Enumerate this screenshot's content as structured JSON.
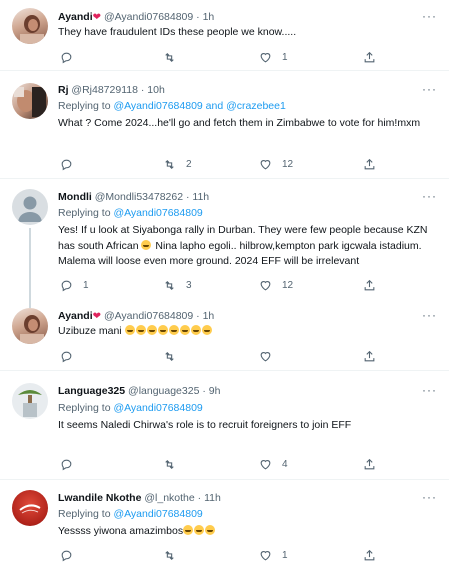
{
  "colors": {
    "link": "#1d9bf0",
    "secondary": "#536471",
    "text": "#0f1419",
    "heart": "#e0245e"
  },
  "tweets": [
    {
      "name": "Ayandi",
      "handle": "@Ayandi07684809",
      "time": "1h",
      "text": "They have fraudulent IDs these people we know.....",
      "replies": "",
      "retweets": "",
      "likes": "1",
      "share": ""
    },
    {
      "name": "Rj",
      "handle": "@Rj48729118",
      "time": "10h",
      "replying_prefix": "Replying to",
      "replying_to": "@Ayandi07684809",
      "replying_and": "and",
      "replying_to2": "@crazebee1",
      "text": "What ?  Come 2024...he'll go and fetch them in Zimbabwe to vote for him!mxm",
      "replies": "",
      "retweets": "2",
      "likes": "12",
      "share": ""
    },
    {
      "name": "Mondli",
      "handle": "@Mondli53478262",
      "time": "11h",
      "replying_prefix": "Replying to",
      "replying_to": "@Ayandi07684809",
      "text_a": "Yes! If u look at Siyabonga rally in Durban. They were few people because KZN has south African",
      "text_b": "Nina lapho egoli.. hilbrow,kempton park  igcwala istadium. Malema will loose even more ground. 2024 EFF will be irrelevant",
      "replies": "1",
      "retweets": "3",
      "likes": "12",
      "share": ""
    },
    {
      "name": "Ayandi",
      "handle": "@Ayandi07684809",
      "time": "1h",
      "text": "Uzibuze mani",
      "replies": "",
      "retweets": "",
      "likes": "",
      "share": ""
    },
    {
      "name": "Language325",
      "handle": "@language325",
      "time": "9h",
      "replying_prefix": "Replying to",
      "replying_to": "@Ayandi07684809",
      "text": "It seems Naledi Chirwa's role is to recruit foreigners to join EFF",
      "replies": "",
      "retweets": "",
      "likes": "4",
      "share": ""
    },
    {
      "name": "Lwandile Nkothe",
      "handle": "@l_nkothe",
      "time": "11h",
      "replying_prefix": "Replying to",
      "replying_to": "@Ayandi07684809",
      "text": "Yessss yiwona amazimbos",
      "replies": "",
      "retweets": "",
      "likes": "1",
      "share": ""
    }
  ],
  "icons": {
    "reply": "reply-icon",
    "retweet": "retweet-icon",
    "like": "heart-icon",
    "share": "share-icon",
    "more": "more-icon"
  }
}
